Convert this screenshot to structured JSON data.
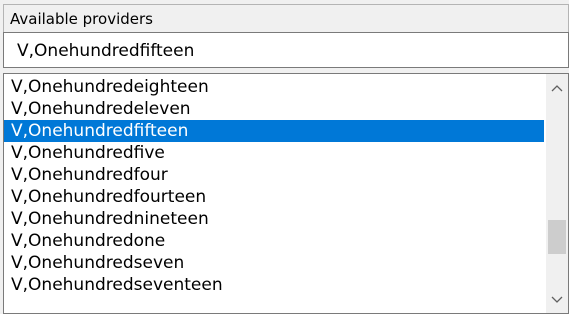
{
  "group": {
    "label": "Available providers"
  },
  "selected_value": "V,Onehundredfifteen",
  "list": {
    "items": [
      "V,Onehundredeighteen",
      "V,Onehundredeleven",
      "V,Onehundredfifteen",
      "V,Onehundredfive",
      "V,Onehundredfour",
      "V,Onehundredfourteen",
      "V,Onehundrednineteen",
      "V,Onehundredone",
      "V,Onehundredseven",
      "V,Onehundredseventeen"
    ],
    "selected_index": 2
  },
  "scrollbar": {
    "up_icon": "chevron-up-icon",
    "down_icon": "chevron-down-icon",
    "position_fraction": 0.78
  },
  "colors": {
    "selection_bg": "#0078d7",
    "selection_text": "#ffffff"
  }
}
